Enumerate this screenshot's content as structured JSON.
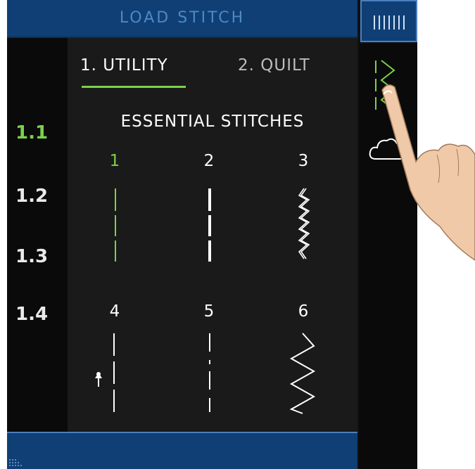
{
  "header": {
    "title": "LOAD STITCH"
  },
  "sidebar": {
    "items": [
      {
        "label": "1.1",
        "active": true
      },
      {
        "label": "1.2",
        "active": false
      },
      {
        "label": "1.3",
        "active": false
      },
      {
        "label": "1.4",
        "active": false
      }
    ]
  },
  "tabs": [
    {
      "label": "1. UTILITY",
      "active": true
    },
    {
      "label": "2. QUILT",
      "active": false
    }
  ],
  "section": {
    "title": "ESSENTIAL STITCHES"
  },
  "stitches": [
    {
      "number": "1",
      "icon": "straight-stitch-icon",
      "selected": true
    },
    {
      "number": "2",
      "icon": "triple-straight-stitch-icon",
      "selected": false
    },
    {
      "number": "3",
      "icon": "triple-zigzag-stitch-icon",
      "selected": false
    },
    {
      "number": "4",
      "icon": "straight-stitch-left-needle-icon",
      "selected": false
    },
    {
      "number": "5",
      "icon": "basting-stitch-icon",
      "selected": false
    },
    {
      "number": "6",
      "icon": "zigzag-stitch-icon",
      "selected": false
    }
  ],
  "colors": {
    "accent_green": "#7bd14a",
    "header_blue": "#0f3f74",
    "header_text_blue": "#4e88c7",
    "background": "#111111"
  }
}
